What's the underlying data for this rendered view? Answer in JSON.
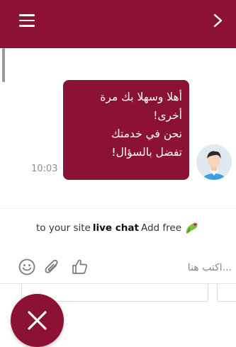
{
  "colors": {
    "brand": "#8c1235",
    "bubble_text": "#ffffff",
    "timestamp": "#8d8d8d"
  },
  "header": {
    "menu_icon": "hamburger-icon",
    "next_icon": "chevron-right-icon"
  },
  "message": {
    "lines": [
      "أهلا وسهلا بك مرة",
      "أخرى!",
      "نحن في خدمتك",
      "تفضل بالسؤال!"
    ],
    "time": "10:03",
    "avatar_icon": "agent-avatar"
  },
  "branding": {
    "pre": "to your site",
    "bold": "live chat",
    "post": "Add free",
    "icon": "parrot-logo-icon"
  },
  "composer": {
    "placeholder": "...اكتب هنا",
    "icons": [
      "emoji-icon",
      "paperclip-icon",
      "thumbs-up-icon"
    ]
  },
  "fab": {
    "icon": "close-icon"
  }
}
